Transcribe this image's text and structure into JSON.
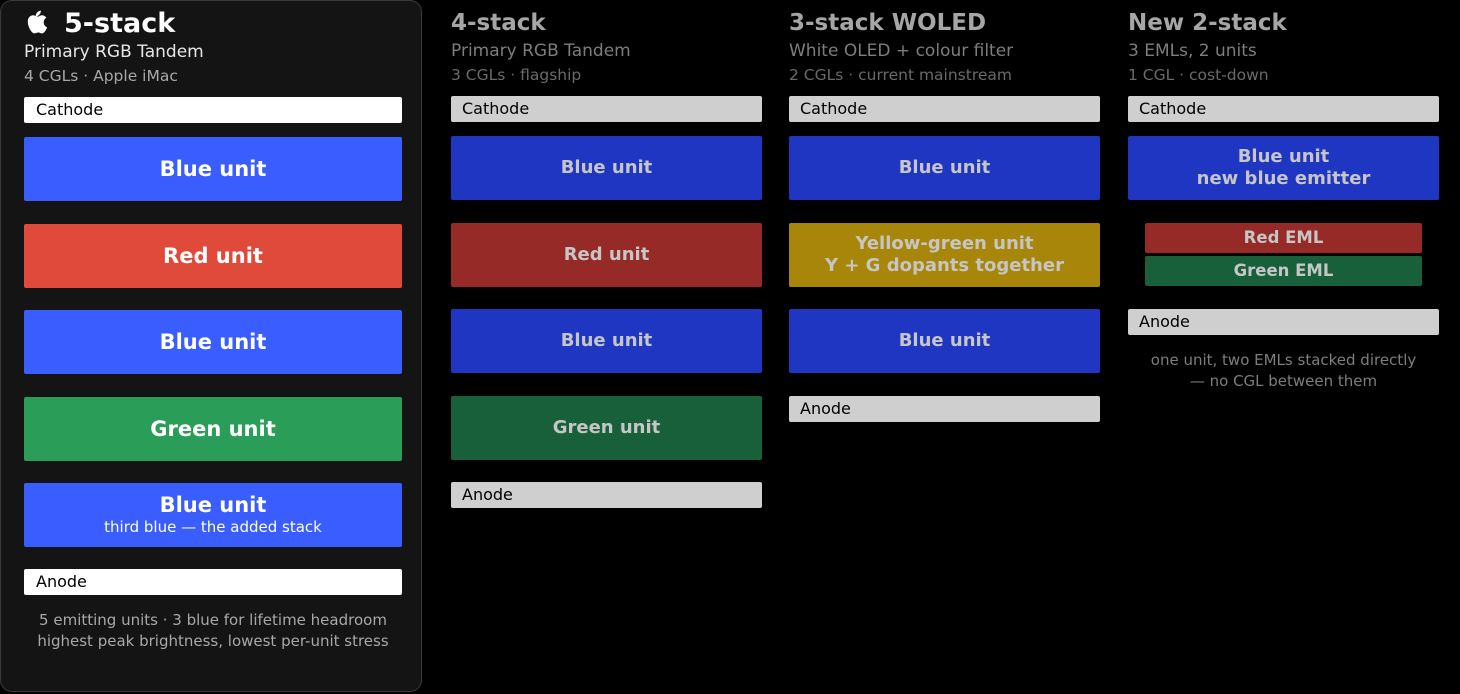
{
  "colors": {
    "blue_bright": "#3a5dff",
    "red_bright": "#e04a3a",
    "green_bright": "#2a9e58",
    "blue_dim": "#1f36c2",
    "red_dim": "#962a26",
    "green_dim": "#17603a",
    "yellow_dim": "#a8860a"
  },
  "stacks": [
    {
      "title": "5-stack",
      "icon": "apple-logo-icon",
      "subtitle": "Primary RGB Tandem",
      "detail": "4 CGLs · Apple iMac",
      "cathode": "Cathode",
      "units": [
        {
          "label": "Blue unit",
          "color": "blue"
        },
        {
          "label": "Red unit",
          "color": "red"
        },
        {
          "label": "Blue unit",
          "color": "blue"
        },
        {
          "label": "Green unit",
          "color": "green"
        },
        {
          "label": "Blue unit",
          "note": "third blue — the added stack",
          "color": "blue"
        }
      ],
      "anode": "Anode",
      "caption": [
        "5 emitting units · 3 blue for lifetime headroom",
        "highest peak brightness, lowest per-unit stress"
      ]
    },
    {
      "title": "4-stack",
      "subtitle": "Primary RGB Tandem",
      "detail": "3 CGLs · flagship",
      "cathode": "Cathode",
      "units": [
        {
          "label": "Blue unit",
          "color": "blue"
        },
        {
          "label": "Red unit",
          "color": "red"
        },
        {
          "label": "Blue unit",
          "color": "blue"
        },
        {
          "label": "Green unit",
          "color": "green"
        }
      ],
      "anode": "Anode"
    },
    {
      "title": "3-stack WOLED",
      "subtitle": "White OLED + colour filter",
      "detail": "2 CGLs · current mainstream",
      "cathode": "Cathode",
      "units": [
        {
          "label": "Blue unit",
          "color": "blue"
        },
        {
          "label": "Yellow-green unit",
          "label2": "Y + G dopants together",
          "color": "yellow"
        },
        {
          "label": "Blue unit",
          "color": "blue"
        }
      ],
      "anode": "Anode"
    },
    {
      "title": "New 2-stack",
      "subtitle": "3 EMLs, 2 units",
      "detail": "1 CGL · cost-down",
      "cathode": "Cathode",
      "units": [
        {
          "label": "Blue unit",
          "label2": "new blue emitter",
          "color": "blue"
        }
      ],
      "emls": [
        {
          "label": "Red EML",
          "color": "red"
        },
        {
          "label": "Green EML",
          "color": "green"
        }
      ],
      "anode": "Anode",
      "caption": [
        "one unit, two EMLs stacked directly",
        "— no CGL between them"
      ]
    }
  ]
}
